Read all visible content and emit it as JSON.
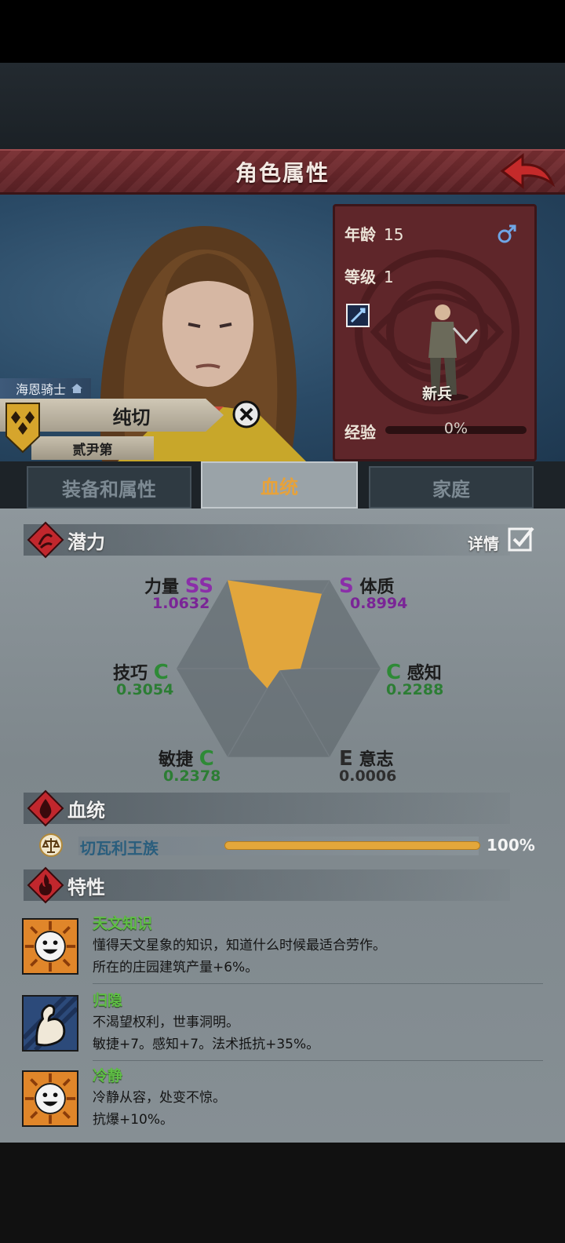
{
  "header": {
    "title": "角色属性"
  },
  "character": {
    "title_tag": "海恩骑士",
    "name": "纯切",
    "house": "贰尹第"
  },
  "info": {
    "age_label": "年龄",
    "age_value": "15",
    "level_label": "等级",
    "level_value": "1",
    "class_name": "新兵",
    "exp_label": "经验",
    "exp_value": "0%",
    "exp_fraction": 0
  },
  "tabs": [
    {
      "label": "装备和属性",
      "active": false
    },
    {
      "label": "血统",
      "active": true
    },
    {
      "label": "家庭",
      "active": false
    }
  ],
  "potential": {
    "section_title": "潜力",
    "detail_label": "详情",
    "detail_checked": true,
    "stats": [
      {
        "name": "力量",
        "grade": "SS",
        "value": "1.0632",
        "color": "purple"
      },
      {
        "name": "体质",
        "grade": "S",
        "value": "0.8994",
        "color": "purple"
      },
      {
        "name": "感知",
        "grade": "C",
        "value": "0.2288",
        "color": "green"
      },
      {
        "name": "意志",
        "grade": "E",
        "value": "0.0006",
        "color": "gray"
      },
      {
        "name": "敏捷",
        "grade": "C",
        "value": "0.2378",
        "color": "green"
      },
      {
        "name": "技巧",
        "grade": "C",
        "value": "0.3054",
        "color": "green"
      }
    ],
    "radar_color": "#e2a63c"
  },
  "bloodline": {
    "section_title": "血统",
    "entries": [
      {
        "name": "切瓦利王族",
        "percent": "100%",
        "fraction": 1.0
      }
    ]
  },
  "traits": {
    "section_title": "特性",
    "items": [
      {
        "name": "天文知识",
        "desc": "懂得天文星象的知识，知道什么时候最适合劳作。",
        "effect": "所在的庄园建筑产量+6%。",
        "icon": "smiley-sun-icon"
      },
      {
        "name": "归隐",
        "desc": "不渴望权利，世事洞明。",
        "effect": "敏捷+7。感知+7。法术抵抗+35%。",
        "icon": "muscle-arm-icon"
      },
      {
        "name": "冷静",
        "desc": "冷静从容，处变不惊。",
        "effect": "抗爆+10%。",
        "icon": "smiley-sun-icon"
      }
    ]
  }
}
